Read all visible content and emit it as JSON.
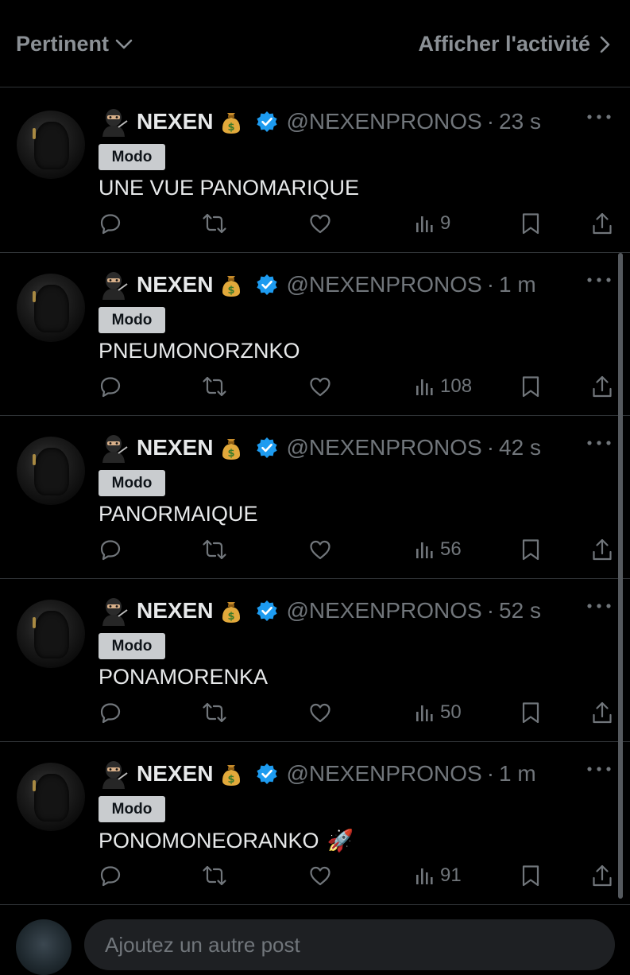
{
  "topbar": {
    "sort_label": "Pertinent",
    "activity_label": "Afficher l'activité"
  },
  "colors": {
    "background": "#000000",
    "text_primary": "#e7e9ea",
    "text_secondary": "#71767b",
    "verified_blue": "#1d9bf0",
    "badge_bg": "#c9cccf",
    "divider": "#2f3336"
  },
  "posts": [
    {
      "name": "NEXEN",
      "handle": "@NEXENPRONOS",
      "dot": "·",
      "time": "23 s",
      "badge": "Modo",
      "text": "UNE VUE PANOMARIQUE",
      "emoji": "",
      "views": "9"
    },
    {
      "name": "NEXEN",
      "handle": "@NEXENPRONOS",
      "dot": "·",
      "time": "1 m",
      "badge": "Modo",
      "text": "PNEUMONORZNKO",
      "emoji": "",
      "views": "108"
    },
    {
      "name": "NEXEN",
      "handle": "@NEXENPRONOS",
      "dot": "·",
      "time": "42 s",
      "badge": "Modo",
      "text": "PANORMAIQUE",
      "emoji": "",
      "views": "56"
    },
    {
      "name": "NEXEN",
      "handle": "@NEXENPRONOS",
      "dot": "·",
      "time": "52 s",
      "badge": "Modo",
      "text": "PONAMORENKA",
      "emoji": "",
      "views": "50"
    },
    {
      "name": "NEXEN",
      "handle": "@NEXENPRONOS",
      "dot": "·",
      "time": "1 m",
      "badge": "Modo",
      "text": "PONOMONEORANKO",
      "emoji": "🚀",
      "views": "91"
    }
  ],
  "composer": {
    "placeholder": "Ajoutez un autre post"
  },
  "icons": {
    "sort": "chevron-down-icon",
    "activity": "chevron-right-icon",
    "name_prefix": "ninja-emoji-icon",
    "name_suffix": "money-bag-emoji-icon",
    "verified": "verified-badge-icon",
    "more": "more-icon",
    "reply": "reply-icon",
    "repost": "repost-icon",
    "like": "heart-icon",
    "views": "views-icon",
    "bookmark": "bookmark-icon",
    "share": "share-icon"
  }
}
